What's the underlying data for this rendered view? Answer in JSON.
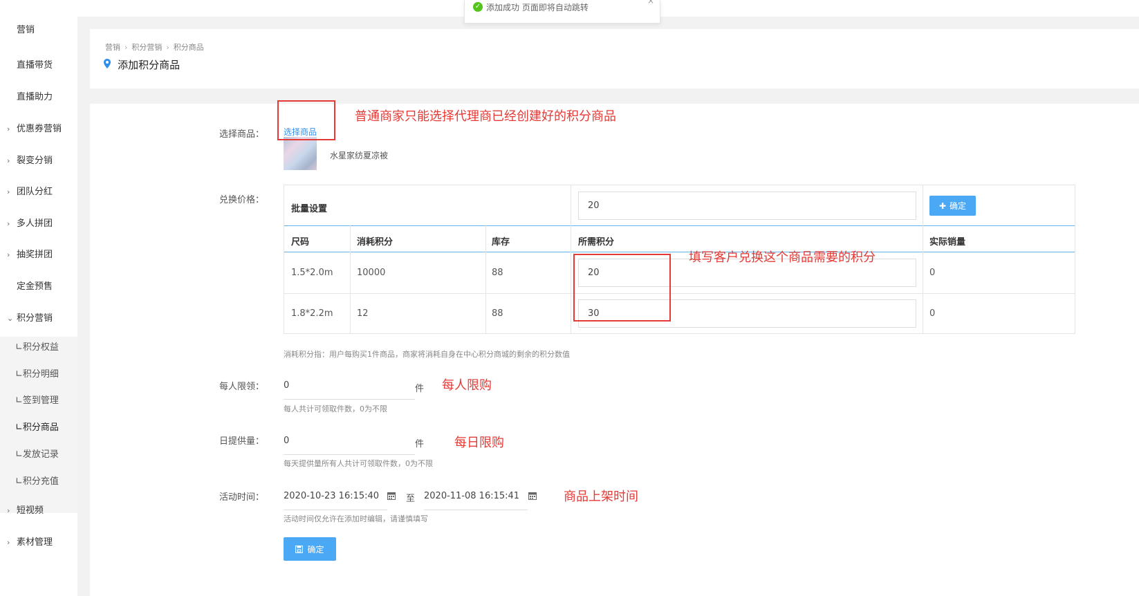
{
  "toast": {
    "message": "添加成功 页面即将自动跳转",
    "close": "×"
  },
  "sidebar": {
    "items": [
      {
        "label": "营销",
        "arrow": ""
      },
      {
        "label": "直播带货",
        "arrow": ""
      },
      {
        "label": "直播助力",
        "arrow": ""
      },
      {
        "label": "优惠券营销",
        "arrow": "›"
      },
      {
        "label": "裂变分销",
        "arrow": "›"
      },
      {
        "label": "团队分红",
        "arrow": "›"
      },
      {
        "label": "多人拼团",
        "arrow": "›"
      },
      {
        "label": "抽奖拼团",
        "arrow": "›"
      },
      {
        "label": "定金预售",
        "arrow": ""
      },
      {
        "label": "积分营销",
        "arrow": "⌄"
      },
      {
        "label": "短视频",
        "arrow": "›"
      },
      {
        "label": "素材管理",
        "arrow": "›"
      }
    ],
    "subitems": [
      {
        "label": "∟积分权益"
      },
      {
        "label": "∟积分明细"
      },
      {
        "label": "∟签到管理"
      },
      {
        "label": "∟积分商品"
      },
      {
        "label": "∟发放记录"
      },
      {
        "label": "∟积分充值"
      }
    ]
  },
  "breadcrumb": [
    "营销",
    "积分营销",
    "积分商品"
  ],
  "breadcrumb_sep": "›",
  "page_title": "添加积分商品",
  "form": {
    "select_product_label": "选择商品：",
    "select_product_link": "选择商品",
    "product_name": "水星家纺夏凉被",
    "exchange_price_label": "兑换价格：",
    "batch_label": "批量设置",
    "batch_value": "20",
    "batch_confirm": "确定",
    "columns": [
      "尺码",
      "消耗积分",
      "库存",
      "所需积分",
      "实际销量"
    ],
    "rows": [
      {
        "size": "1.5*2.0m",
        "cost": "10000",
        "stock": "88",
        "points": "20",
        "sales": "0"
      },
      {
        "size": "1.8*2.2m",
        "cost": "12",
        "stock": "88",
        "points": "30",
        "sales": "0"
      }
    ],
    "cost_hint": "消耗积分指：用户每购买1件商品，商家将消耗自身在中心积分商城的剩余的积分数值",
    "per_person_label": "每人限领：",
    "per_person_value": "0",
    "per_person_unit": "件",
    "per_person_hint": "每人共计可领取件数，0为不限",
    "daily_label": "日提供量：",
    "daily_value": "0",
    "daily_unit": "件",
    "daily_hint": "每天提供量所有人共计可领取件数，0为不限",
    "time_label": "活动时间：",
    "time_start": "2020-10-23 16:15:40",
    "time_to": "至",
    "time_end": "2020-11-08 16:15:41",
    "time_hint": "活动时间仅允许在添加时编辑，请谨慎填写",
    "submit": "确定"
  },
  "annotations": {
    "select_note": "普通商家只能选择代理商已经创建好的积分商品",
    "points_note": "填写客户兑换这个商品需要的积分",
    "per_person_note": "每人限购",
    "daily_note": "每日限购",
    "time_note": "商品上架时间"
  },
  "colors": {
    "accent": "#2e8ff0",
    "button": "#4aa8f5",
    "annotation": "#e53935",
    "success": "#52c41a"
  }
}
